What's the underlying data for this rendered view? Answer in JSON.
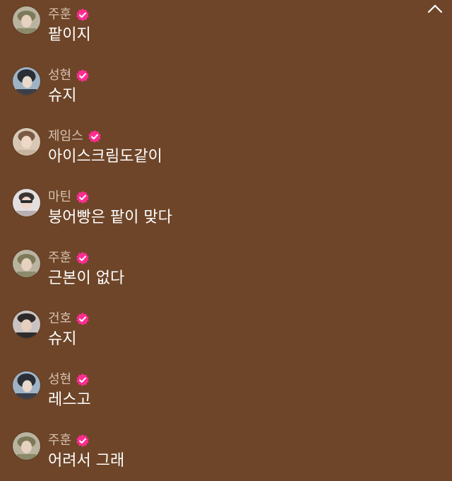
{
  "colors": {
    "background": "#6e4528",
    "name_text": "#d7c2b1",
    "message_text": "#ffffff",
    "badge": "#ff2d91"
  },
  "controls": {
    "collapse_icon": "chevron-up-icon"
  },
  "messages": [
    {
      "name": "주훈",
      "text": "팥이지",
      "verified": true
    },
    {
      "name": "성현",
      "text": "슈지",
      "verified": true
    },
    {
      "name": "제임스",
      "text": "아이스크림도같이",
      "verified": true
    },
    {
      "name": "마틴",
      "text": "붕어빵은 팥이 맞다",
      "verified": true
    },
    {
      "name": "주훈",
      "text": "근본이 없다",
      "verified": true
    },
    {
      "name": "건호",
      "text": "슈지",
      "verified": true
    },
    {
      "name": "성현",
      "text": "레스고",
      "verified": true
    },
    {
      "name": "주훈",
      "text": "어려서 그래",
      "verified": true
    }
  ]
}
